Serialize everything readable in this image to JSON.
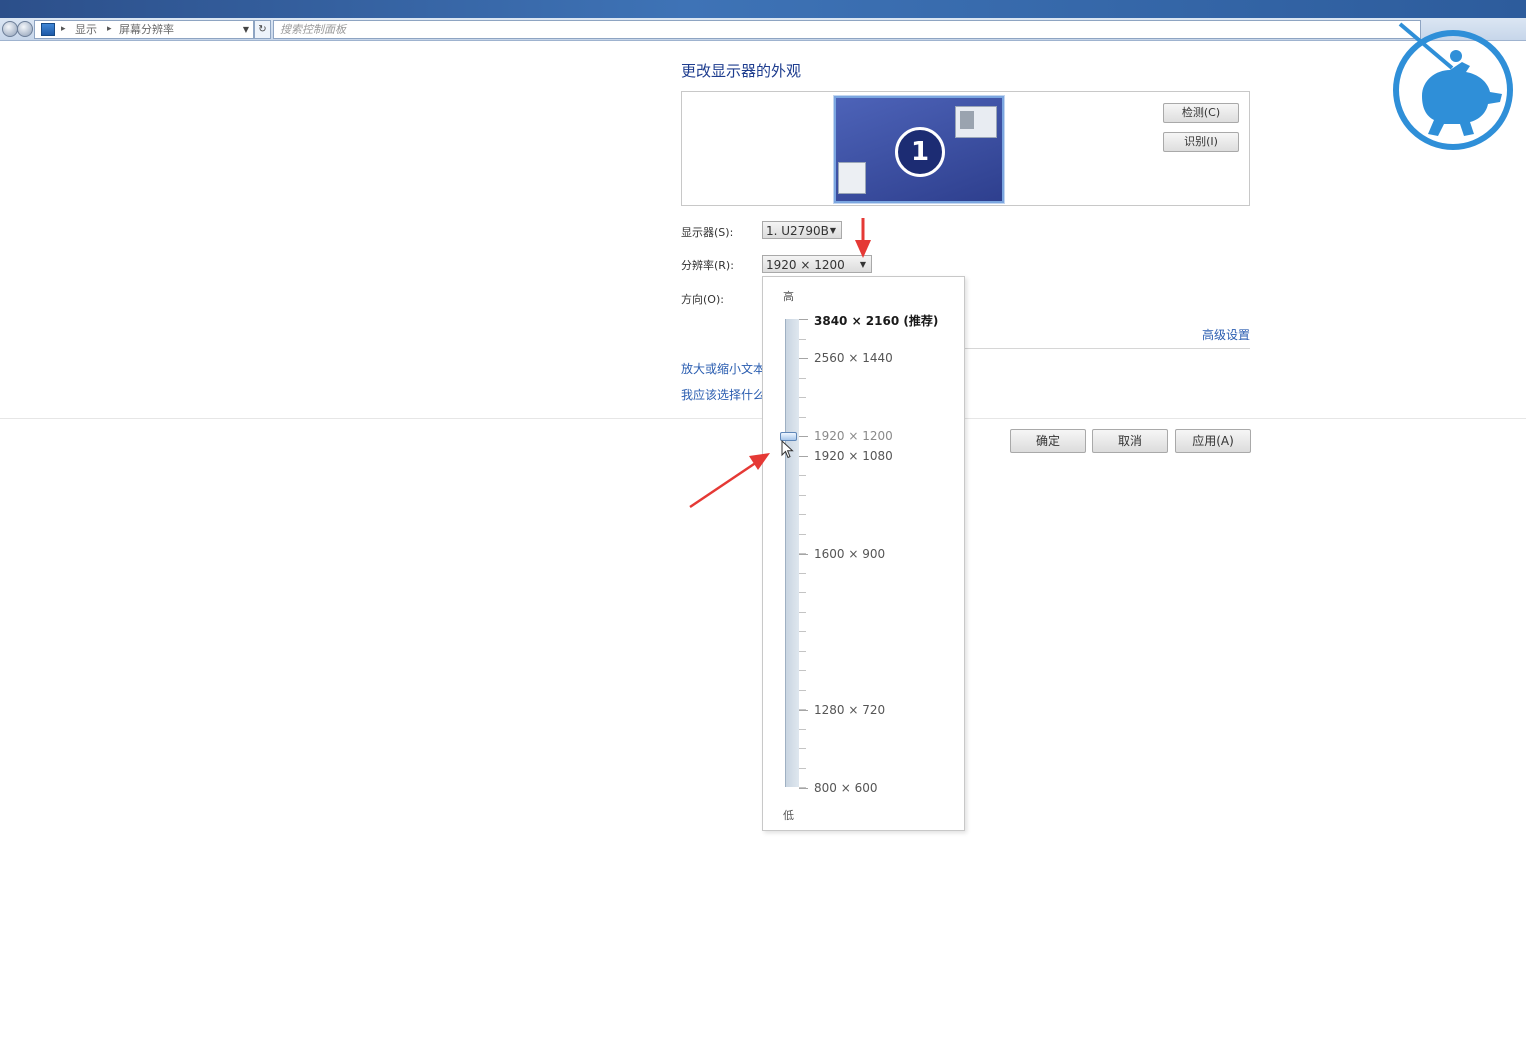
{
  "address_bar": {
    "breadcrumbs": [
      "显示",
      "屏幕分辨率"
    ],
    "search_placeholder": "搜索控制面板"
  },
  "page": {
    "heading": "更改显示器的外观",
    "monitor_number": "1",
    "detect_button": "检测(C)",
    "identify_button": "识别(I)"
  },
  "fields": {
    "display_label": "显示器(S):",
    "display_value": "1. U2790B",
    "resolution_label": "分辨率(R):",
    "resolution_value": "1920 × 1200",
    "orientation_label": "方向(O):"
  },
  "links": {
    "advanced": "高级设置",
    "enlarge_text": "放大或缩小文本和其他项目",
    "which_settings": "我应该选择什么显示器设置?"
  },
  "buttons": {
    "ok": "确定",
    "cancel": "取消",
    "apply": "应用(A)"
  },
  "resolution_dropdown": {
    "high_label": "高",
    "low_label": "低",
    "options": [
      {
        "label": "3840 × 2160 (推荐)",
        "recommended": true
      },
      {
        "label": "2560 × 1440"
      },
      {
        "label": "1920 × 1200",
        "current": true
      },
      {
        "label": "1920 × 1080"
      },
      {
        "label": "1600 × 900"
      },
      {
        "label": "1280 × 720"
      },
      {
        "label": "800 × 600"
      }
    ]
  },
  "colors": {
    "link": "#2a5db0",
    "heading": "#1e3d8f",
    "annotation_arrow": "#e53935",
    "logo": "#2f8fd8"
  }
}
